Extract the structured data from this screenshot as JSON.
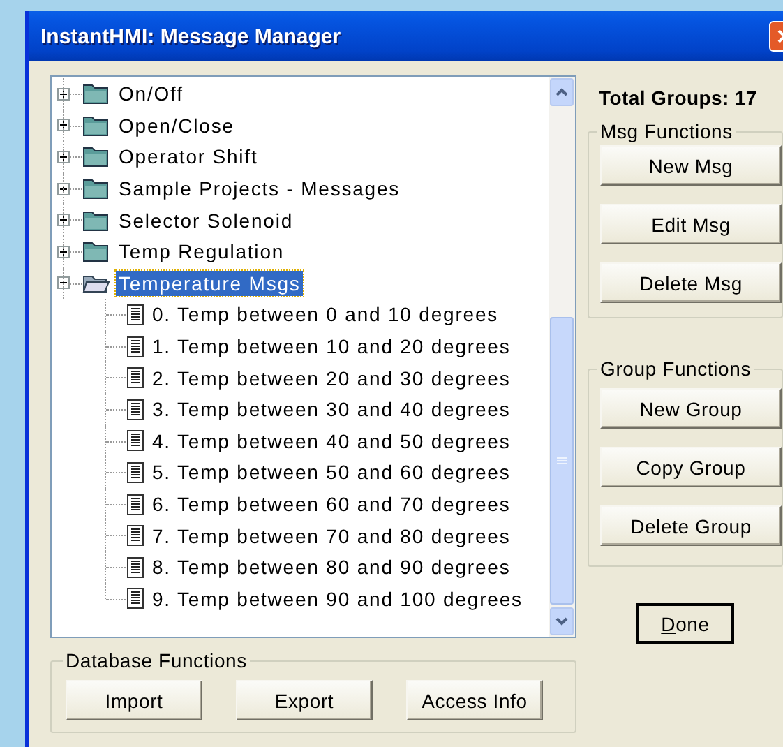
{
  "window": {
    "title": "InstantHMI: Message Manager"
  },
  "tree": [
    {
      "label": "On/Off",
      "expanded": false,
      "selected": false
    },
    {
      "label": "Open/Close",
      "expanded": false,
      "selected": false
    },
    {
      "label": "Operator Shift",
      "expanded": false,
      "selected": false
    },
    {
      "label": "Sample Projects - Messages",
      "expanded": false,
      "selected": false
    },
    {
      "label": "Selector Solenoid",
      "expanded": false,
      "selected": false
    },
    {
      "label": "Temp Regulation",
      "expanded": false,
      "selected": false
    },
    {
      "label": "Temperature Msgs",
      "expanded": true,
      "selected": true,
      "children": [
        {
          "label": "0. Temp between 0 and 10 degrees",
          "selected": false
        },
        {
          "label": "1. Temp between 10 and 20 degrees",
          "selected": false
        },
        {
          "label": "2. Temp between 20 and 30 degrees",
          "selected": false
        },
        {
          "label": "3. Temp between 30 and 40 degrees",
          "selected": false
        },
        {
          "label": "4. Temp between 40 and 50 degrees",
          "selected": false
        },
        {
          "label": "5. Temp between 50 and 60 degrees",
          "selected": false
        },
        {
          "label": "6. Temp between 60 and 70 degrees",
          "selected": false
        },
        {
          "label": "7. Temp between 70 and 80 degrees",
          "selected": false
        },
        {
          "label": "8. Temp between 80 and 90 degrees",
          "selected": false
        },
        {
          "label": "9. Temp between 90 and 100 degrees",
          "selected": false
        }
      ]
    }
  ],
  "total_groups": "Total Groups: 17",
  "msg_functions": {
    "title": "Msg Functions",
    "buttons": [
      "New Msg",
      "Edit Msg",
      "Delete Msg"
    ]
  },
  "group_functions": {
    "title": "Group Functions",
    "buttons": [
      "New Group",
      "Copy Group",
      "Delete Group"
    ]
  },
  "database_functions": {
    "title": "Database Functions",
    "buttons": [
      "Import",
      "Export",
      "Access Info"
    ]
  },
  "done_button": "Done"
}
